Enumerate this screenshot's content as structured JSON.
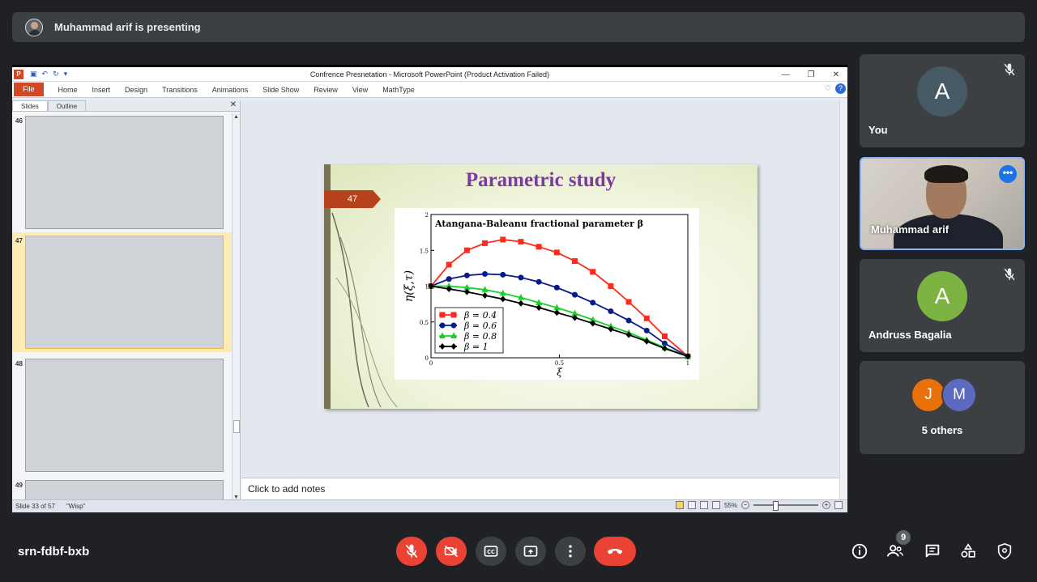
{
  "banner": {
    "text": "Muhammad arif is presenting"
  },
  "powerpoint": {
    "window_title": "Confrence Presnetation - Microsoft PowerPoint (Product Activation Failed)",
    "tabs": [
      "Home",
      "Insert",
      "Design",
      "Transitions",
      "Animations",
      "Slide Show",
      "Review",
      "View",
      "MathType"
    ],
    "file_tab": "File",
    "pane_tabs": [
      "Slides",
      "Outline"
    ],
    "thumbnails": [
      {
        "num": "46",
        "selected": false
      },
      {
        "num": "47",
        "selected": true
      },
      {
        "num": "48",
        "selected": false
      },
      {
        "num": "49",
        "selected": false
      }
    ],
    "notes_placeholder": "Click to add notes",
    "status": {
      "slide_info": "Slide 33 of 57",
      "theme": "\"Wisp\"",
      "zoom": "55%"
    }
  },
  "slide": {
    "title": "Parametric study",
    "number": "47"
  },
  "chart_data": {
    "type": "line",
    "title": "Atangana-Baleanu fractional parameter β",
    "xlabel": "ξ",
    "ylabel": "η(ξ,τ)",
    "xlim": [
      0,
      1
    ],
    "ylim": [
      0,
      2
    ],
    "xticks": [
      "0",
      "0.5",
      "1"
    ],
    "yticks": [
      "0",
      "0.5",
      "1",
      "1.5",
      "2"
    ],
    "x": [
      0,
      0.07,
      0.14,
      0.21,
      0.28,
      0.35,
      0.42,
      0.49,
      0.56,
      0.63,
      0.7,
      0.77,
      0.84,
      0.91,
      1.0
    ],
    "series": [
      {
        "name": "β = 0.4",
        "color": "#ff2a1a",
        "marker": "square",
        "values": [
          1.0,
          1.3,
          1.5,
          1.6,
          1.65,
          1.62,
          1.55,
          1.47,
          1.35,
          1.2,
          1.0,
          0.78,
          0.55,
          0.3,
          0.02
        ]
      },
      {
        "name": "β = 0.6",
        "color": "#0a1a8c",
        "marker": "circle",
        "values": [
          1.0,
          1.1,
          1.15,
          1.17,
          1.16,
          1.12,
          1.06,
          0.98,
          0.88,
          0.77,
          0.65,
          0.52,
          0.38,
          0.2,
          0.02
        ]
      },
      {
        "name": "β = 0.8",
        "color": "#18d02a",
        "marker": "triangle",
        "values": [
          1.0,
          1.0,
          0.98,
          0.95,
          0.9,
          0.84,
          0.77,
          0.7,
          0.62,
          0.53,
          0.44,
          0.35,
          0.25,
          0.14,
          0.02
        ]
      },
      {
        "name": "β =   1",
        "color": "#000000",
        "marker": "diamond",
        "values": [
          1.0,
          0.96,
          0.92,
          0.87,
          0.82,
          0.76,
          0.7,
          0.63,
          0.56,
          0.48,
          0.4,
          0.32,
          0.23,
          0.13,
          0.02
        ]
      }
    ],
    "legend_position": "bottom-left"
  },
  "participants": {
    "you": {
      "initial": "A",
      "name": "You",
      "color": "#455a64"
    },
    "presenter": {
      "name": "Muhammad arif"
    },
    "andruss": {
      "initial": "A",
      "name": "Andruss Bagalia",
      "color": "#7cb342"
    },
    "others": {
      "initials": [
        "J",
        "M"
      ],
      "label": "5 others"
    }
  },
  "meeting": {
    "code": "srn-fdbf-bxb",
    "people_count": "9"
  }
}
